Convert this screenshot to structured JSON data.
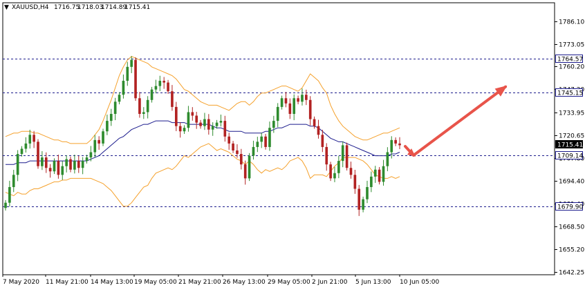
{
  "header": {
    "symbol_label": "XAUUSD,H4",
    "open": "1716.75",
    "high": "1718.03",
    "low": "1714.89",
    "close": "1715.41"
  },
  "chart_data": {
    "type": "candlestick",
    "symbol": "XAUUSD",
    "timeframe": "H4",
    "ylim": [
      1642.25,
      1793.0
    ],
    "y_ticks": [
      1786.1,
      1773.05,
      1760.2,
      1747.2,
      1733.95,
      1720.65,
      1707.8,
      1694.4,
      1681.4,
      1668.5,
      1655.2,
      1642.25
    ],
    "y_tick_labels": [
      "1786.10",
      "1773.05",
      "1760.20",
      "1747.20",
      "1733.95",
      "1720.65",
      "1707.80",
      "1694.40",
      "1681.40",
      "1668.50",
      "1655.20",
      "1642.25"
    ],
    "x_tick_labels": [
      "7 May 2020",
      "11 May 21:00",
      "14 May 13:00",
      "19 May 05:00",
      "21 May 21:00",
      "26 May 13:00",
      "29 May 05:00",
      "2 Jun 21:00",
      "5 Jun 13:00",
      "10 Jun 05:00"
    ],
    "horizontal_levels": [
      {
        "value": 1764.57,
        "label": "1764.57",
        "style": "dashed",
        "color": "#1a1a8c"
      },
      {
        "value": 1745.15,
        "label": "1745.15",
        "style": "dashed",
        "color": "#1a1a8c"
      },
      {
        "value": 1709.14,
        "label": "1709.14",
        "style": "dashed",
        "color": "#1a1a8c"
      },
      {
        "value": 1679.9,
        "label": "1679.90",
        "style": "dashed",
        "color": "#1a1a8c"
      }
    ],
    "current_price": {
      "value": 1715.41,
      "label": "1715.41"
    },
    "candles_close": [
      1682,
      1691,
      1698,
      1710,
      1713,
      1716,
      1721,
      1717,
      1703,
      1708,
      1702,
      1700,
      1706,
      1698,
      1703,
      1707,
      1701,
      1706,
      1702,
      1706,
      1708,
      1711,
      1718,
      1716,
      1723,
      1729,
      1733,
      1740,
      1744,
      1752,
      1760,
      1764,
      1742,
      1733,
      1734,
      1741,
      1747,
      1749,
      1752,
      1751,
      1746,
      1737,
      1726,
      1723,
      1725,
      1734,
      1732,
      1728,
      1726,
      1730,
      1724,
      1726,
      1728,
      1729,
      1720,
      1716,
      1712,
      1710,
      1704,
      1696,
      1709,
      1714,
      1717,
      1720,
      1714,
      1725,
      1729,
      1737,
      1742,
      1739,
      1733,
      1742,
      1740,
      1744,
      1741,
      1730,
      1726,
      1721,
      1714,
      1704,
      1696,
      1699,
      1706,
      1715,
      1702,
      1698,
      1690,
      1678,
      1684,
      1691,
      1697,
      1701,
      1694,
      1703,
      1711,
      1718,
      1716,
      1715
    ],
    "series": [
      {
        "name": "Moving Average",
        "color": "#1a1a8c",
        "values": [
          1704,
          1704,
          1704,
          1705,
          1705,
          1705,
          1706,
          1706,
          1706,
          1706,
          1706,
          1706,
          1706,
          1706,
          1706,
          1706,
          1706,
          1706,
          1706,
          1706,
          1706,
          1707,
          1708,
          1709,
          1711,
          1713,
          1715,
          1717,
          1719,
          1720,
          1722,
          1724,
          1725,
          1726,
          1727,
          1727,
          1728,
          1729,
          1729,
          1729,
          1729,
          1728,
          1728,
          1728,
          1728,
          1727,
          1727,
          1727,
          1727,
          1727,
          1727,
          1726,
          1725,
          1725,
          1724,
          1723,
          1723,
          1723,
          1723,
          1722,
          1722,
          1722,
          1722,
          1722,
          1723,
          1723,
          1724,
          1725,
          1725,
          1726,
          1727,
          1727,
          1727,
          1727,
          1727,
          1726,
          1726,
          1725,
          1723,
          1721,
          1719,
          1718,
          1717,
          1717,
          1716,
          1715,
          1714,
          1713,
          1712,
          1711,
          1710,
          1709,
          1709,
          1709,
          1709,
          1710,
          1710,
          1711
        ]
      },
      {
        "name": "Upper Band",
        "color": "#f5a02a",
        "values": [
          1720,
          1721,
          1722,
          1722,
          1723,
          1723,
          1723,
          1722,
          1722,
          1721,
          1720,
          1719,
          1718,
          1718,
          1717,
          1717,
          1716,
          1716,
          1716,
          1716,
          1716,
          1718,
          1721,
          1724,
          1729,
          1735,
          1741,
          1748,
          1755,
          1760,
          1764,
          1766,
          1765,
          1764,
          1763,
          1762,
          1760,
          1759,
          1758,
          1757,
          1756,
          1755,
          1753,
          1750,
          1747,
          1746,
          1744,
          1742,
          1740,
          1739,
          1738,
          1738,
          1738,
          1737,
          1736,
          1735,
          1737,
          1739,
          1740,
          1740,
          1738,
          1740,
          1743,
          1745,
          1745,
          1746,
          1747,
          1748,
          1749,
          1749,
          1748,
          1747,
          1746,
          1748,
          1752,
          1756,
          1754,
          1752,
          1748,
          1745,
          1738,
          1733,
          1729,
          1726,
          1724,
          1722,
          1720,
          1719,
          1718,
          1718,
          1719,
          1720,
          1721,
          1722,
          1722,
          1723,
          1724,
          1725
        ]
      },
      {
        "name": "Lower Band",
        "color": "#f5a02a",
        "values": [
          1688,
          1687,
          1686,
          1688,
          1687,
          1687,
          1689,
          1690,
          1690,
          1691,
          1692,
          1693,
          1694,
          1694,
          1695,
          1695,
          1696,
          1696,
          1696,
          1696,
          1696,
          1696,
          1695,
          1694,
          1693,
          1691,
          1689,
          1686,
          1683,
          1680,
          1680,
          1682,
          1685,
          1688,
          1691,
          1692,
          1696,
          1699,
          1700,
          1701,
          1702,
          1701,
          1703,
          1706,
          1709,
          1708,
          1710,
          1712,
          1714,
          1715,
          1716,
          1714,
          1712,
          1713,
          1712,
          1711,
          1709,
          1707,
          1706,
          1704,
          1706,
          1704,
          1701,
          1699,
          1701,
          1700,
          1701,
          1702,
          1701,
          1703,
          1706,
          1707,
          1708,
          1706,
          1702,
          1696,
          1698,
          1698,
          1698,
          1697,
          1700,
          1703,
          1705,
          1708,
          1708,
          1708,
          1708,
          1707,
          1706,
          1704,
          1701,
          1698,
          1697,
          1696,
          1696,
          1697,
          1696,
          1697
        ]
      }
    ],
    "annotation_arrows": [
      {
        "color": "#e8544a",
        "from_index": 97,
        "from_value": 1710,
        "to_index": 110,
        "to_value": 1745,
        "style": "hook-down-then-up"
      }
    ],
    "grid": false
  }
}
